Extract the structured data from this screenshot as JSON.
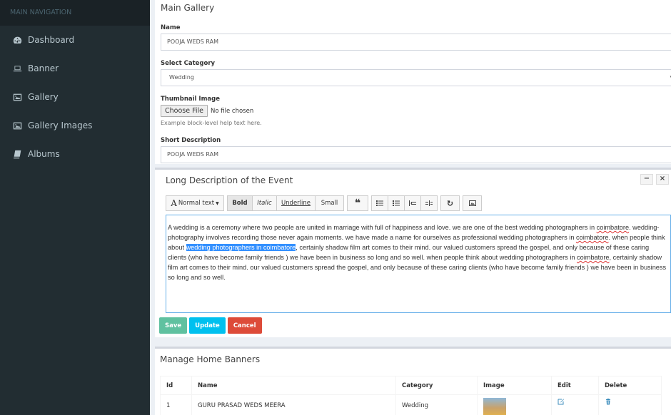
{
  "sidebar": {
    "header": "MAIN NAVIGATION",
    "items": [
      {
        "label": "Dashboard",
        "icon": "dashboard-icon"
      },
      {
        "label": "Banner",
        "icon": "laptop-icon"
      },
      {
        "label": "Gallery",
        "icon": "image-icon"
      },
      {
        "label": "Gallery Images",
        "icon": "image-icon"
      },
      {
        "label": "Albums",
        "icon": "book-icon"
      }
    ]
  },
  "gallery": {
    "title": "Main Gallery",
    "name_label": "Name",
    "name_value": "POOJA WEDS RAM",
    "category_label": "Select Category",
    "category_value": "Wedding",
    "thumb_label": "Thumbnail Image",
    "choose_file": "Choose File",
    "no_file": "No file chosen",
    "help_text": "Example block-level help text here.",
    "short_label": "Short Description",
    "short_value": "POOJA WEDS RAM"
  },
  "editor": {
    "title": "Long Description of the Event",
    "toolbar": {
      "normal_text": "Normal text",
      "bold": "Bold",
      "italic": "Italic",
      "underline": "Underline",
      "small": "Small",
      "quote": "❝"
    },
    "text": {
      "p1": "A wedding is a ceremony where two people are united in marriage with full of happiness and love. we are one of the best wedding photographers in ",
      "w1": "coimbatore",
      "p2": ". wedding-photography involves recording those never again moments. we have made a name for ourselves as professional wedding photographers in ",
      "w2": "coimbatore",
      "p3": ". when people think about ",
      "selected": "wedding photographers in coimbatore",
      "p4": ", certainly shadow film art comes to their mind. our valued customers spread the gospel, and only because of these caring clients (who have become family friends ) we have been in business so long and so well. when people think about wedding photographers in ",
      "w3": "coimbatore",
      "p5": ", certainly shadow film art comes to their mind. our valued customers spread the gospel, and only because of these caring clients (who have become family friends ) we have been in business so long and so well."
    },
    "buttons": {
      "save": "Save",
      "update": "Update",
      "cancel": "Cancel"
    }
  },
  "banners": {
    "title": "Manage Home Banners",
    "columns": [
      "Id",
      "Name",
      "Category",
      "Image",
      "Edit",
      "Delete"
    ],
    "rows": [
      {
        "id": "1",
        "name": "GURU PRASAD WEDS MEERA",
        "category": "Wedding"
      }
    ]
  },
  "colors": {
    "sidebar_bg": "#222d32",
    "accent": "#3c8dbc",
    "save": "#60c1a0",
    "update": "#00c0ef",
    "cancel": "#dd4b39"
  }
}
